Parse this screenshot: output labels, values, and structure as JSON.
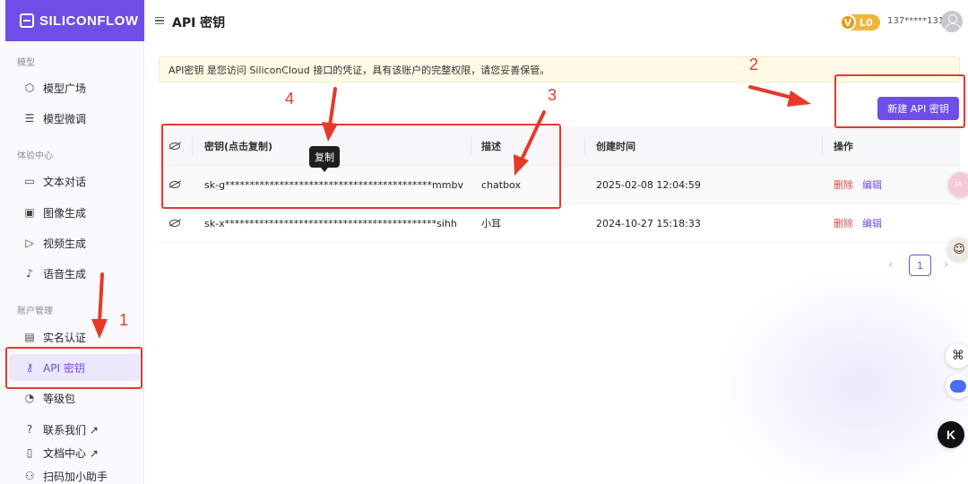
{
  "brand": {
    "name": "SILICONFLOW"
  },
  "header": {
    "title": "API 密钥",
    "level": "L0",
    "vip_letter": "V",
    "phone": "137*****131"
  },
  "sidebar": {
    "section_model": "模型",
    "items_model": [
      {
        "label": "模型广场",
        "icon": "cube-icon"
      },
      {
        "label": "模型微调",
        "icon": "sliders-icon"
      }
    ],
    "section_experience": "体验中心",
    "items_experience": [
      {
        "label": "文本对话",
        "icon": "chat-icon"
      },
      {
        "label": "图像生成",
        "icon": "image-icon"
      },
      {
        "label": "视频生成",
        "icon": "video-icon"
      },
      {
        "label": "语音生成",
        "icon": "mic-icon"
      }
    ],
    "section_account": "账户管理",
    "items_account": [
      {
        "label": "实名认证",
        "icon": "id-card-icon"
      },
      {
        "label": "API 密钥",
        "icon": "key-icon"
      },
      {
        "label": "等级包",
        "icon": "gauge-icon"
      }
    ],
    "items_footer": [
      {
        "label": "联系我们 ↗",
        "icon": "help-icon"
      },
      {
        "label": "文档中心 ↗",
        "icon": "doc-icon"
      },
      {
        "label": "扫码加小助手",
        "icon": "people-icon"
      }
    ]
  },
  "notice": "API密钥 是您访问 SiliconCloud 接口的凭证，具有该账户的完整权限，请您妥善保管。",
  "new_key_button": "新建 API 密钥",
  "table": {
    "headers": {
      "key": "密钥(点击复制)",
      "desc": "描述",
      "created": "创建时间",
      "ops": "操作"
    },
    "rows": [
      {
        "key": "sk-g******************************************mmbv",
        "desc": "chatbox",
        "created": "2025-02-08 12:04:59",
        "delete": "删除",
        "edit": "编辑"
      },
      {
        "key": "sk-x*******************************************sihh",
        "desc": "小耳",
        "created": "2024-10-27 15:18:33",
        "delete": "删除",
        "edit": "编辑"
      }
    ]
  },
  "tooltip": "复制",
  "pagination": {
    "current": "1",
    "prev": "‹",
    "next": "›"
  },
  "annotations": {
    "n1": "1",
    "n2": "2",
    "n3": "3",
    "n4": "4"
  },
  "colors": {
    "accent": "#6e4ee6",
    "annotation": "#e53a2a",
    "notice_bg": "#fffbe6",
    "danger": "#e5484d"
  }
}
